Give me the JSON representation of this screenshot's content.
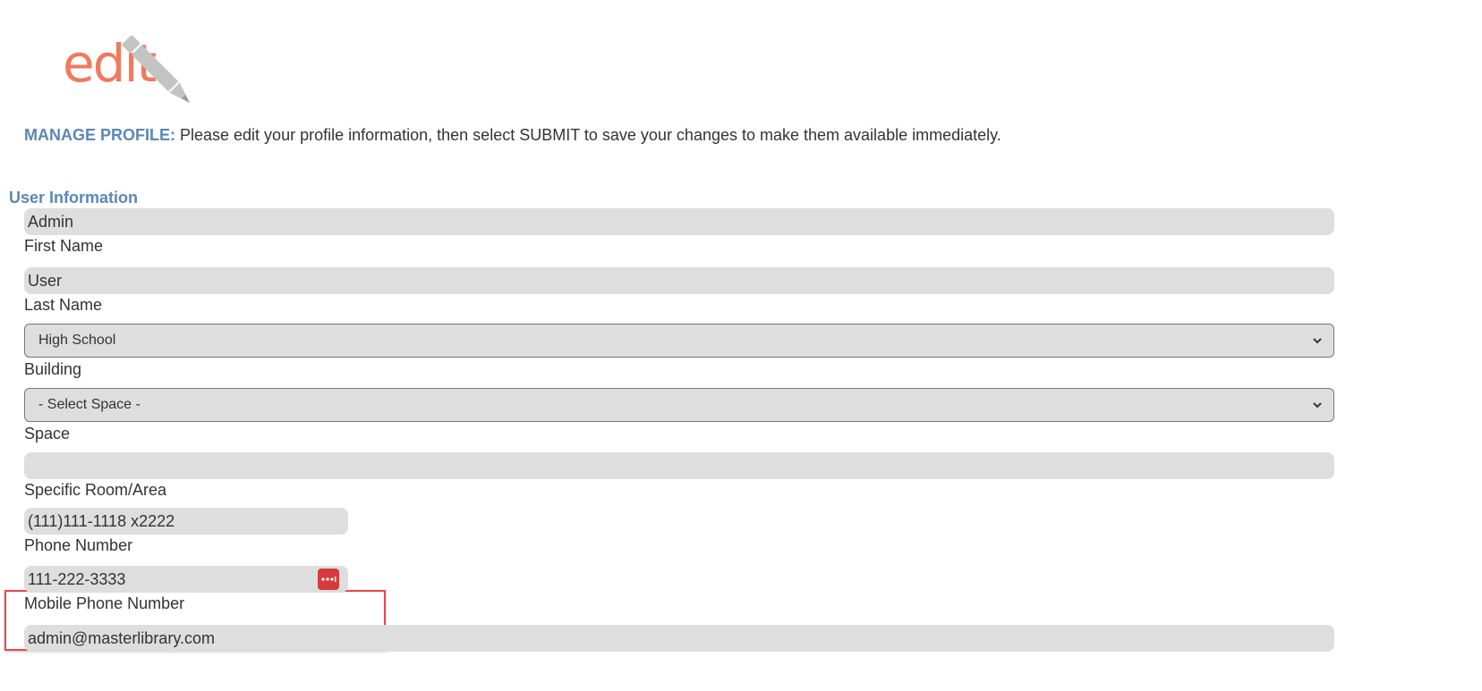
{
  "logo": {
    "text": "edit"
  },
  "intro": {
    "label": "MANAGE PROFILE:",
    "text": " Please edit your profile information, then select SUBMIT to save your changes to make them available immediately."
  },
  "section": {
    "title": "User Information"
  },
  "fields": {
    "first_name": {
      "value": "Admin",
      "label": "First Name"
    },
    "last_name": {
      "value": "User",
      "label": "Last Name"
    },
    "building": {
      "value": "High School",
      "label": "Building"
    },
    "space": {
      "value": "- Select Space -",
      "label": "Space"
    },
    "room": {
      "value": "",
      "label": "Specific Room/Area"
    },
    "phone": {
      "value": "(111)111-1118  x2222",
      "label": "Phone Number"
    },
    "mobile": {
      "value": "111-222-3333",
      "label": "Mobile Phone Number"
    },
    "email": {
      "value": "admin@masterlibrary.com"
    }
  },
  "colors": {
    "accent": "#5b87b6",
    "logo": "#f07a5e",
    "field_bg": "#dedede",
    "highlight": "#e44a4a"
  },
  "icons": {
    "pencil": "pencil-icon",
    "chevron": "chevron-down-icon",
    "password_manager": "password-manager-icon"
  }
}
